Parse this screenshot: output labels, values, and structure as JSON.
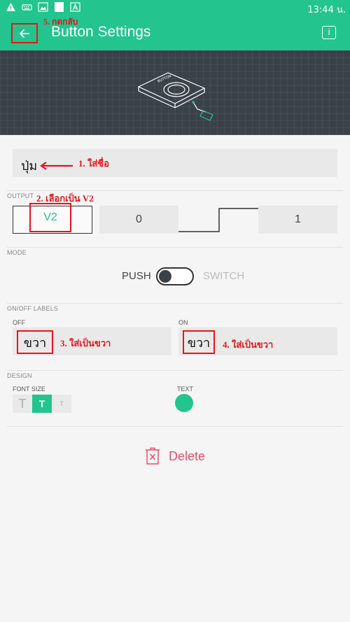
{
  "statusbar": {
    "time": "13:44 น."
  },
  "appbar": {
    "title": "Button Settings",
    "info_glyph": "i"
  },
  "widget_preview": {
    "device_label": "BUTTON"
  },
  "name_field": {
    "value": "ปุ่ม"
  },
  "annotations": {
    "name": "1. ใส่ชื่อ",
    "output": "2. เลือกเป็น V2",
    "off": "3. ใส่เป็นขวา",
    "on": "4. ใส่เป็นขวา",
    "back": "5. กดกลับ"
  },
  "output": {
    "section_label": "OUTPUT",
    "pin": "V2",
    "low_value": "0",
    "high_value": "1"
  },
  "mode": {
    "section_label": "MODE",
    "push_label": "PUSH",
    "switch_label": "SWITCH",
    "selected": "PUSH"
  },
  "labels": {
    "section_label": "ON/OFF LABELS",
    "off_label": "OFF",
    "off_value": "ขวา",
    "on_label": "ON",
    "on_value": "ขวา"
  },
  "design": {
    "section_label": "DESIGN",
    "font_size_label": "FONT SIZE",
    "font_sizes": [
      "T",
      "T",
      "T"
    ],
    "selected_font_size": 1,
    "text_label": "TEXT",
    "text_color": "#23c48e"
  },
  "delete": {
    "label": "Delete"
  },
  "colors": {
    "accent": "#23c48e",
    "annotation": "#e8141b",
    "delete": "#e8506a",
    "preview_bg": "#3a4148"
  }
}
